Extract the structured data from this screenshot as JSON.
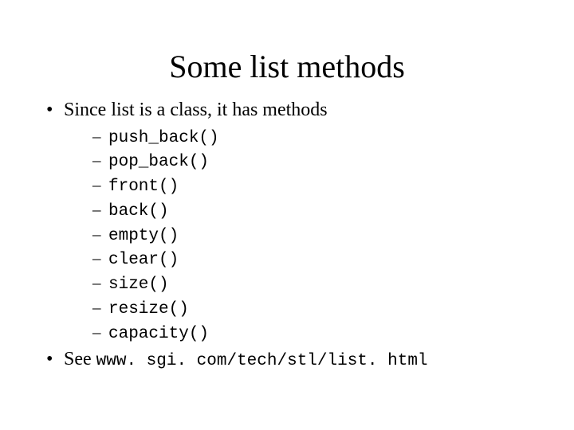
{
  "title": "Some list methods",
  "bullets": {
    "first": "Since list is a class, it has methods",
    "methods": [
      "push_back()",
      "pop_back()",
      "front()",
      "back()",
      "empty()",
      "clear()",
      "size()",
      "resize()",
      "capacity()"
    ],
    "see_prefix": "See ",
    "see_url": "www. sgi. com/tech/stl/list. html"
  }
}
